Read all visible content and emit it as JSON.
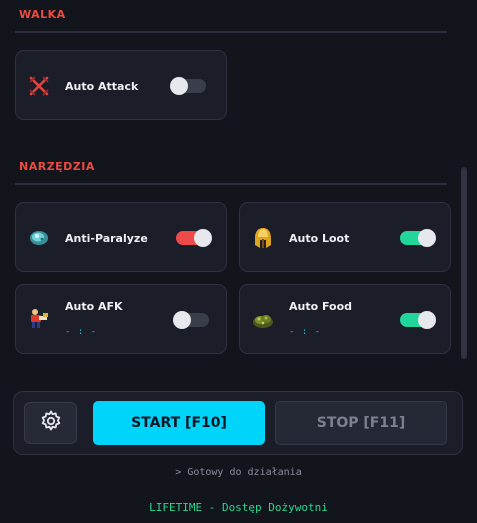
{
  "sections": {
    "combat": {
      "title": "WALKA"
    },
    "tools": {
      "title": "NARZĘDZIA"
    }
  },
  "features": {
    "auto_attack": {
      "label": "Auto Attack",
      "enabled": false,
      "icon": "crossed-swords-icon"
    },
    "anti_paralyze": {
      "label": "Anti-Paralyze",
      "enabled": true,
      "toggle_color": "#ef4a4a",
      "icon": "paralyze-rune-icon"
    },
    "auto_loot": {
      "label": "Auto Loot",
      "enabled": true,
      "toggle_color": "#22d69a",
      "icon": "golden-helmet-icon"
    },
    "auto_afk": {
      "label": "Auto AFK",
      "sub": "- : -",
      "enabled": false,
      "icon": "afk-character-icon"
    },
    "auto_food": {
      "label": "Auto Food",
      "sub": "- : -",
      "enabled": true,
      "toggle_color": "#22d69a",
      "icon": "food-icon"
    }
  },
  "controls": {
    "start_label": "START [F10]",
    "stop_label": "STOP [F11]",
    "settings_icon": "gear-icon"
  },
  "status_text": "> Gotowy do działania",
  "license_text": "LIFETIME - Dostęp Dożywotni",
  "colors": {
    "background": "#13151d",
    "accent": "#00d4fa",
    "section_title": "#ef4a3f",
    "toggle_on": "#22d69a",
    "toggle_on_alt": "#ef4a4a",
    "license": "#28d890"
  }
}
